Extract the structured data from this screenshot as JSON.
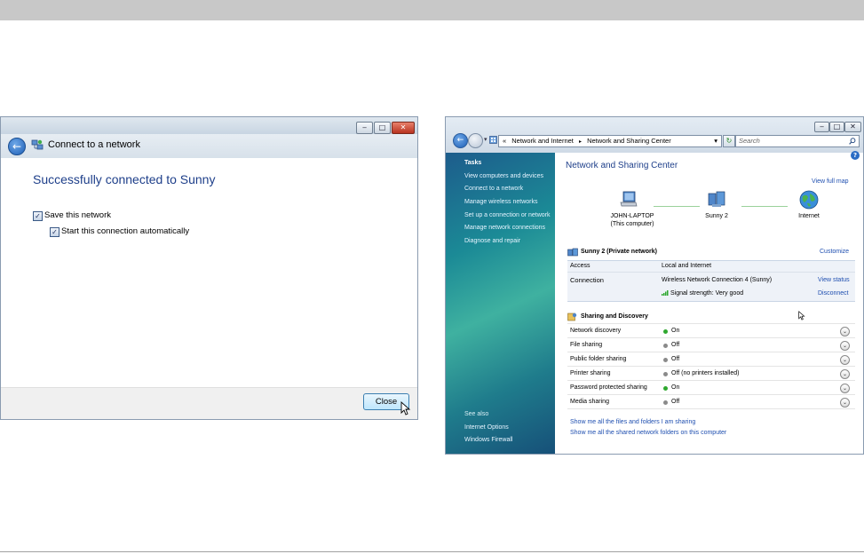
{
  "left_dialog": {
    "title": "Connect to a network",
    "heading": "Successfully connected to Sunny",
    "checkbox_save": {
      "label": "Save this network",
      "checked": true
    },
    "checkbox_auto": {
      "label": "Start this connection automatically",
      "checked": true
    },
    "close_button": "Close",
    "window_buttons": {
      "minimize": "‒",
      "maximize": "□",
      "close": "✕"
    },
    "back_icon": "back-arrow-icon",
    "title_icon": "network-icon"
  },
  "right_window": {
    "address_bar": {
      "prefix": "«",
      "crumb1": "Network and Internet",
      "sep": "▸",
      "crumb2": "Network and Sharing Center",
      "dropdown": "▾"
    },
    "refresh": "↻",
    "search_placeholder": "Search",
    "window_buttons": {
      "minimize": "‒",
      "maximize": "□",
      "close": "✕"
    },
    "help": "?",
    "sidebar": {
      "tasks_heading": "Tasks",
      "tasks": [
        "View computers and devices",
        "Connect to a network",
        "Manage wireless networks",
        "Set up a connection or network",
        "Manage network connections",
        "Diagnose and repair"
      ],
      "see_also_heading": "See also",
      "see_also": [
        "Internet Options",
        "Windows Firewall"
      ]
    },
    "title": "Network and Sharing Center",
    "view_full_map": "View full map",
    "map": {
      "computer_name": "JOHN-LAPTOP",
      "computer_sub": "(This computer)",
      "network_name": "Sunny  2",
      "internet": "Internet"
    },
    "network": {
      "name": "Sunny  2 (Private network)",
      "customize": "Customize",
      "access_label": "Access",
      "access_value": "Local and Internet",
      "connection_label": "Connection",
      "connection_value": "Wireless Network Connection 4 (Sunny)",
      "view_status": "View status",
      "signal": "Signal strength:  Very good",
      "disconnect": "Disconnect"
    },
    "sharing": {
      "heading": "Sharing and Discovery",
      "rows": [
        {
          "label": "Network discovery",
          "value": "On",
          "status": "on"
        },
        {
          "label": "File sharing",
          "value": "Off",
          "status": "off"
        },
        {
          "label": "Public folder sharing",
          "value": "Off",
          "status": "off"
        },
        {
          "label": "Printer sharing",
          "value": "Off (no printers installed)",
          "status": "off"
        },
        {
          "label": "Password protected sharing",
          "value": "On",
          "status": "on"
        },
        {
          "label": "Media sharing",
          "value": "Off",
          "status": "off"
        }
      ],
      "expand_glyph": "⌄"
    },
    "links": [
      "Show me all the files and folders I am sharing",
      "Show me all the shared network folders on this computer"
    ]
  },
  "colors": {
    "on": "#2fa82f",
    "off": "#8a8a8a",
    "link": "#1f4fb0",
    "heading": "#1e3f8a"
  }
}
